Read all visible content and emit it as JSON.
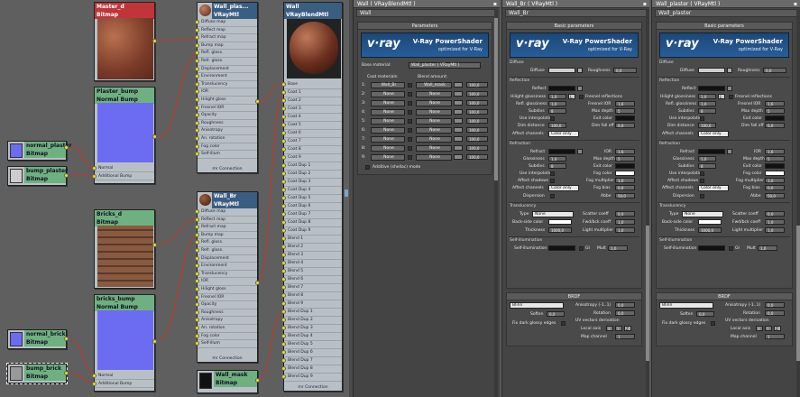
{
  "graph": {
    "nodes": {
      "master": {
        "title": "Master_d",
        "subtitle": "Bitmap"
      },
      "plaster_bump": {
        "title": "Plaster_bump",
        "subtitle": "Normal Bump"
      },
      "normal_plaster": {
        "title": "normal_plaster",
        "subtitle": "Bitmap"
      },
      "bump_plaster": {
        "title": "bump_plaster",
        "subtitle": "Bitmap"
      },
      "wall_plaster_mtl": {
        "title": "Wall_plas...",
        "subtitle": "VRayMtl"
      },
      "wall_blend": {
        "title": "Wall",
        "subtitle": "VRayBlendMtl"
      },
      "bricks_d": {
        "title": "Bricks_d",
        "subtitle": "Bitmap"
      },
      "bricks_bump": {
        "title": "bricks_bump",
        "subtitle": "Normal Bump"
      },
      "normal_brick": {
        "title": "normal_brick",
        "subtitle": "Bitmap"
      },
      "bump_brick": {
        "title": "bump_brick",
        "subtitle": "Bitmap"
      },
      "wall_br_mtl": {
        "title": "Wall_Br",
        "subtitle": "VRayMtl"
      },
      "wall_mask": {
        "title": "Wall_mask",
        "subtitle": "Bitmap"
      }
    },
    "normal_bump_slots": [
      "Normal",
      "Additional Bump"
    ],
    "vraymtl_slots": [
      "Diffuse map",
      "Reflect map",
      "Refract map",
      "Bump map",
      "Refl. gloss.",
      "Refr. gloss.",
      "Displacement",
      "Environment",
      "Translucency",
      "IOR",
      "Hilight gloss",
      "Fresnel IOR",
      "Opacity",
      "Roughness",
      "Anisotropy",
      "An. rotation",
      "Fog color",
      "Self-illum"
    ],
    "vraymtl_conn": "mr Connection",
    "blend_slots": [
      "Base",
      "Coat 1",
      "Coat 2",
      "Coat 3",
      "Coat 4",
      "Coat 5",
      "Coat 6",
      "Coat 7",
      "Coat 8",
      "Coat 9",
      "Coat Dup 1",
      "Coat Dup 2",
      "Coat Dup 3",
      "Coat Dup 4",
      "Coat Dup 5",
      "Coat Dup 6",
      "Coat Dup 7",
      "Coat Dup 8",
      "Coat Dup 9",
      "Blend 1",
      "Blend 2",
      "Blend 3",
      "Blend 4",
      "Blend 5",
      "Blend 6",
      "Blend 7",
      "Blend 8",
      "Blend 9",
      "Blend Dup 1",
      "Blend Dup 2",
      "Blend Dup 3",
      "Blend Dup 4",
      "Blend Dup 5",
      "Blend Dup 6",
      "Blend Dup 7",
      "Blend Dup 8",
      "Blend Dup 9"
    ],
    "blend_conn": "mr Connection"
  },
  "panel1": {
    "title": "Wall ( VRayBlendMtl )",
    "name": "Wall",
    "section": "Parameters",
    "vray": {
      "t1": "V-Ray PowerShader",
      "t2": "optimized for V-Ray"
    },
    "base_label": "Base material:",
    "base_value": "Wall_plaster ( VRayMtl )",
    "coat_header": "Coat materials:",
    "blend_header": "Blend amount:",
    "rows": [
      {
        "n": "1:",
        "coat": "Wall_Br",
        "blend": "Wall_mask",
        "val": "100,0"
      },
      {
        "n": "2:",
        "coat": "None",
        "blend": "None",
        "val": "100,0"
      },
      {
        "n": "3:",
        "coat": "None",
        "blend": "None",
        "val": "100,0"
      },
      {
        "n": "4:",
        "coat": "None",
        "blend": "None",
        "val": "100,0"
      },
      {
        "n": "5:",
        "coat": "None",
        "blend": "None",
        "val": "100,0"
      },
      {
        "n": "6:",
        "coat": "None",
        "blend": "None",
        "val": "100,0"
      },
      {
        "n": "7:",
        "coat": "None",
        "blend": "None",
        "val": "100,0"
      },
      {
        "n": "8:",
        "coat": "None",
        "blend": "None",
        "val": "100,0"
      },
      {
        "n": "9:",
        "coat": "None",
        "blend": "None",
        "val": "100,0"
      }
    ],
    "additive": "Additive (shellac) mode"
  },
  "panel2": {
    "title": "Wall_Br ( VRayMtl )",
    "name": "Wall_Br"
  },
  "panel3": {
    "title": "Wall_plaster ( VRayMtl )",
    "name": "Wall_plaster"
  },
  "vraymtl": {
    "section": "Basic parameters",
    "vray": {
      "t1": "V-Ray PowerShader",
      "t2": "optimized for V-Ray"
    },
    "diffuse_grp": "Diffuse",
    "diffuse": "Diffuse",
    "roughness": "Roughness",
    "roughness_val": "0,0",
    "reflection_grp": "Reflection",
    "reflect": "Reflect",
    "hilight": "Hilight glossiness",
    "refl_gloss": "Refl. glossiness",
    "subdivs": "Subdivs",
    "use_interp": "Use interpolation",
    "dim_dist": "Dim distance",
    "fresnel": "Fresnel reflections",
    "fresnel_ior": "Fresnel IOR",
    "max_depth": "Max depth",
    "exit_color": "Exit color",
    "dim_falloff": "Dim fall off",
    "affect_ch": "Affect channels",
    "color_only": "Color only",
    "l_btn": "L",
    "refraction_grp": "Refraction",
    "refract": "Refract",
    "ior": "IOR",
    "glossiness": "Glossiness",
    "affect_shadows": "Affect shadows",
    "fog_color": "Fog color",
    "fog_mult": "Fog multiplier",
    "fog_bias": "Fog bias",
    "dispersion": "Dispersion",
    "abbe": "Abbe",
    "transl_grp": "Translucency",
    "type": "Type",
    "type_val": "None",
    "backside": "Back-side color",
    "thickness": "Thickness",
    "scatter": "Scatter coeff",
    "fwd_bck": "Fwd/bck coeff",
    "light_mult": "Light multiplier",
    "self_grp": "Self-illumination",
    "self_illum": "Self-illumination",
    "gi": "GI",
    "mult": "Mult",
    "brdf": "BRDF",
    "blinn": "Blinn",
    "soften": "Soften",
    "fix_dark": "Fix dark glossy edges",
    "anisotropy": "Anisotropy (-1..1)",
    "rotation": "Rotation",
    "uv_grp": "UV vectors derivation",
    "local_axis": "Local axis",
    "map_channel": "Map channel",
    "axes": [
      "X",
      "Y",
      "Z"
    ],
    "v": {
      "hilight": "1,0",
      "refl": "1,0",
      "subdivs": "8",
      "fior": "1,6",
      "maxd": "5",
      "dimd": "100,0",
      "dimf": "0,0",
      "ior": "1,6",
      "gloss": "1,0",
      "rsub": "8",
      "rmax": "5",
      "fmult": "1,0",
      "fbias": "0,0",
      "abbe": "50,0",
      "scat": "0,0",
      "fwd": "1,0",
      "thick": "1000,0",
      "light": "1,0",
      "mult": "1,0",
      "soften": "0,0",
      "aniso": "0,0",
      "rot": "0,0",
      "chan": "1"
    }
  },
  "colors": {
    "accent": "#275d9a",
    "yellow": "#e7e21c",
    "wire": "#d83a2a"
  }
}
